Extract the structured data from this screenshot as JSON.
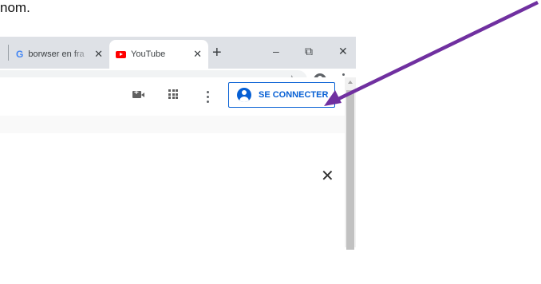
{
  "caption": "nom.",
  "tabs": [
    {
      "label": "borwser en fra",
      "close": "✕"
    },
    {
      "label": "YouTube",
      "close": "✕"
    }
  ],
  "window": {
    "newtab": "+",
    "minimize": "–",
    "restore": "⧉",
    "close": "✕"
  },
  "toolbar": {
    "star": "☆"
  },
  "youtube": {
    "signin_label": "SE CONNECTER",
    "dismiss": "✕"
  },
  "colors": {
    "arrow": "#7030a0",
    "signin_blue": "#065fd4",
    "tabstrip": "#dee1e6"
  }
}
